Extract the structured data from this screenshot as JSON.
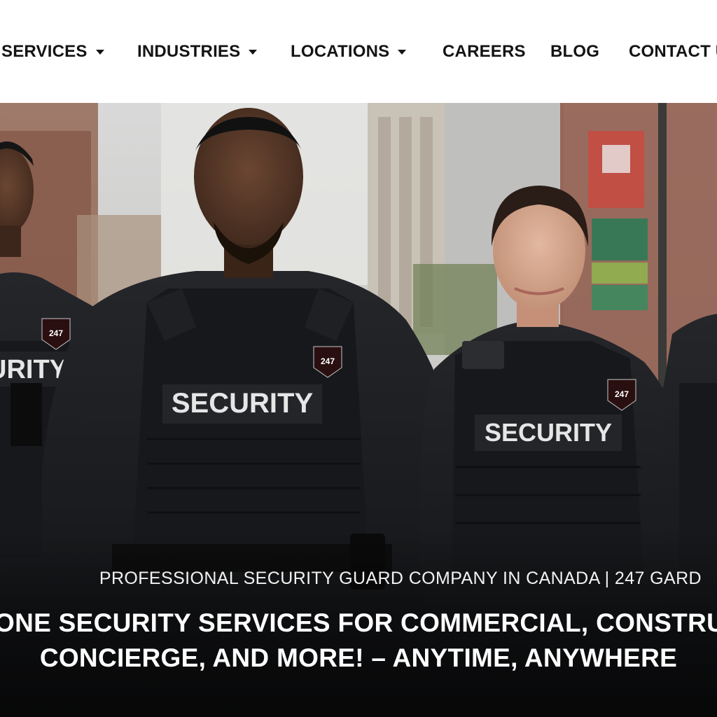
{
  "nav": {
    "items": [
      {
        "label": "SERVICES",
        "has_dropdown": true
      },
      {
        "label": "INDUSTRIES",
        "has_dropdown": true
      },
      {
        "label": "LOCATIONS",
        "has_dropdown": true
      },
      {
        "label": "CAREERS",
        "has_dropdown": false
      },
      {
        "label": "BLOG",
        "has_dropdown": false
      },
      {
        "label": "CONTACT U",
        "has_dropdown": false
      }
    ]
  },
  "hero": {
    "subtitle": "PROFESSIONAL SECURITY GUARD COMPANY IN CANADA | 247 GARD",
    "title_line1": "ONE SECURITY SERVICES FOR COMMERCIAL, CONSTRU",
    "title_line2": "CONCIERGE, AND MORE! – ANYTIME, ANYWHERE",
    "image": {
      "vest_label": "SECURITY",
      "vest_label_partial": "URITY",
      "badge_text": "247"
    }
  },
  "colors": {
    "nav_text": "#141414",
    "nav_bg": "#ffffff",
    "uniform": "#1b1c1f",
    "hero_text": "#ffffff"
  },
  "icons": [
    "chevron-down-icon"
  ]
}
